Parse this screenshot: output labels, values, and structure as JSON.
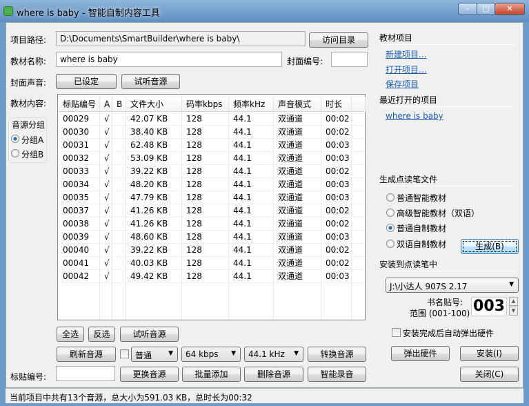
{
  "window": {
    "title": "where is baby - 智能自制内容工具"
  },
  "form": {
    "path_label": "项目路径:",
    "path_value": "D:\\Documents\\SmartBuilder\\where is baby\\",
    "visit_dir": "访问目录",
    "name_label": "教材名称:",
    "name_value": "where is baby",
    "cover_no_label": "封面编号:",
    "cover_no_value": "",
    "cover_sound_label": "封面声音:",
    "cover_set": "已设定",
    "cover_listen": "试听音源",
    "content_label": "教材内容:"
  },
  "source_group": {
    "title": "音源分组",
    "options": [
      {
        "label": "分组A",
        "selected": true
      },
      {
        "label": "分组B",
        "selected": false
      }
    ]
  },
  "table": {
    "columns": [
      "标贴编号",
      "A",
      "B",
      "文件大小",
      "码率kbps",
      "频率kHz",
      "声音模式",
      "时长"
    ],
    "rows": [
      [
        "00029",
        "√",
        "",
        "42.07 KB",
        "128",
        "44.1",
        "双通道",
        "00:02"
      ],
      [
        "00030",
        "√",
        "",
        "38.40 KB",
        "128",
        "44.1",
        "双通道",
        "00:02"
      ],
      [
        "00031",
        "√",
        "",
        "62.48 KB",
        "128",
        "44.1",
        "双通道",
        "00:03"
      ],
      [
        "00032",
        "√",
        "",
        "53.09 KB",
        "128",
        "44.1",
        "双通道",
        "00:03"
      ],
      [
        "00033",
        "√",
        "",
        "39.22 KB",
        "128",
        "44.1",
        "双通道",
        "00:02"
      ],
      [
        "00034",
        "√",
        "",
        "48.20 KB",
        "128",
        "44.1",
        "双通道",
        "00:03"
      ],
      [
        "00035",
        "√",
        "",
        "47.79 KB",
        "128",
        "44.1",
        "双通道",
        "00:03"
      ],
      [
        "00037",
        "√",
        "",
        "41.26 KB",
        "128",
        "44.1",
        "双通道",
        "00:02"
      ],
      [
        "00038",
        "√",
        "",
        "41.26 KB",
        "128",
        "44.1",
        "双通道",
        "00:02"
      ],
      [
        "00039",
        "√",
        "",
        "48.60 KB",
        "128",
        "44.1",
        "双通道",
        "00:03"
      ],
      [
        "00040",
        "√",
        "",
        "39.22 KB",
        "128",
        "44.1",
        "双通道",
        "00:02"
      ],
      [
        "00041",
        "√",
        "",
        "40.03 KB",
        "128",
        "44.1",
        "双通道",
        "00:02"
      ],
      [
        "00042",
        "√",
        "",
        "49.42 KB",
        "128",
        "44.1",
        "双通道",
        "00:03"
      ]
    ]
  },
  "bottom": {
    "select_all": "全选",
    "invert": "反选",
    "listen": "试听音源",
    "refresh": "刷新音源",
    "quality": "普通",
    "bitrate": "64 kbps",
    "freq": "44.1 kHz",
    "convert": "转换音源",
    "sticker_label": "标贴编号:",
    "sticker_value": "",
    "replace": "更换音源",
    "batch_add": "批量添加",
    "delete": "删除音源",
    "record": "智能录音"
  },
  "right": {
    "project_title": "教材项目",
    "new": "新建项目...",
    "open": "打开项目...",
    "save": "保存项目",
    "recent_title": "最近打开的项目",
    "recent": [
      "where is baby"
    ],
    "gen_title": "生成点读笔文件",
    "gen_options": [
      {
        "label": "普通智能教材",
        "selected": false
      },
      {
        "label": "高级智能教材（双语）",
        "selected": false
      },
      {
        "label": "普通自制教材",
        "selected": true
      },
      {
        "label": "双语自制教材",
        "selected": false
      }
    ],
    "generate": "生成(B)",
    "install_title": "安装到点读笔中",
    "device": "J:\\小达人 907S 2.17",
    "book_no_label": "书名贴号:",
    "range_label": "范围 (001-100)",
    "book_no": "003",
    "auto_eject": "安装完成后自动弹出硬件",
    "auto_eject_checked": false,
    "eject": "弹出硬件",
    "install": "安装(I)",
    "close": "关闭(C)"
  },
  "status": "当前项目中共有13个音源，总大小为591.03 KB，总时长为00:32"
}
